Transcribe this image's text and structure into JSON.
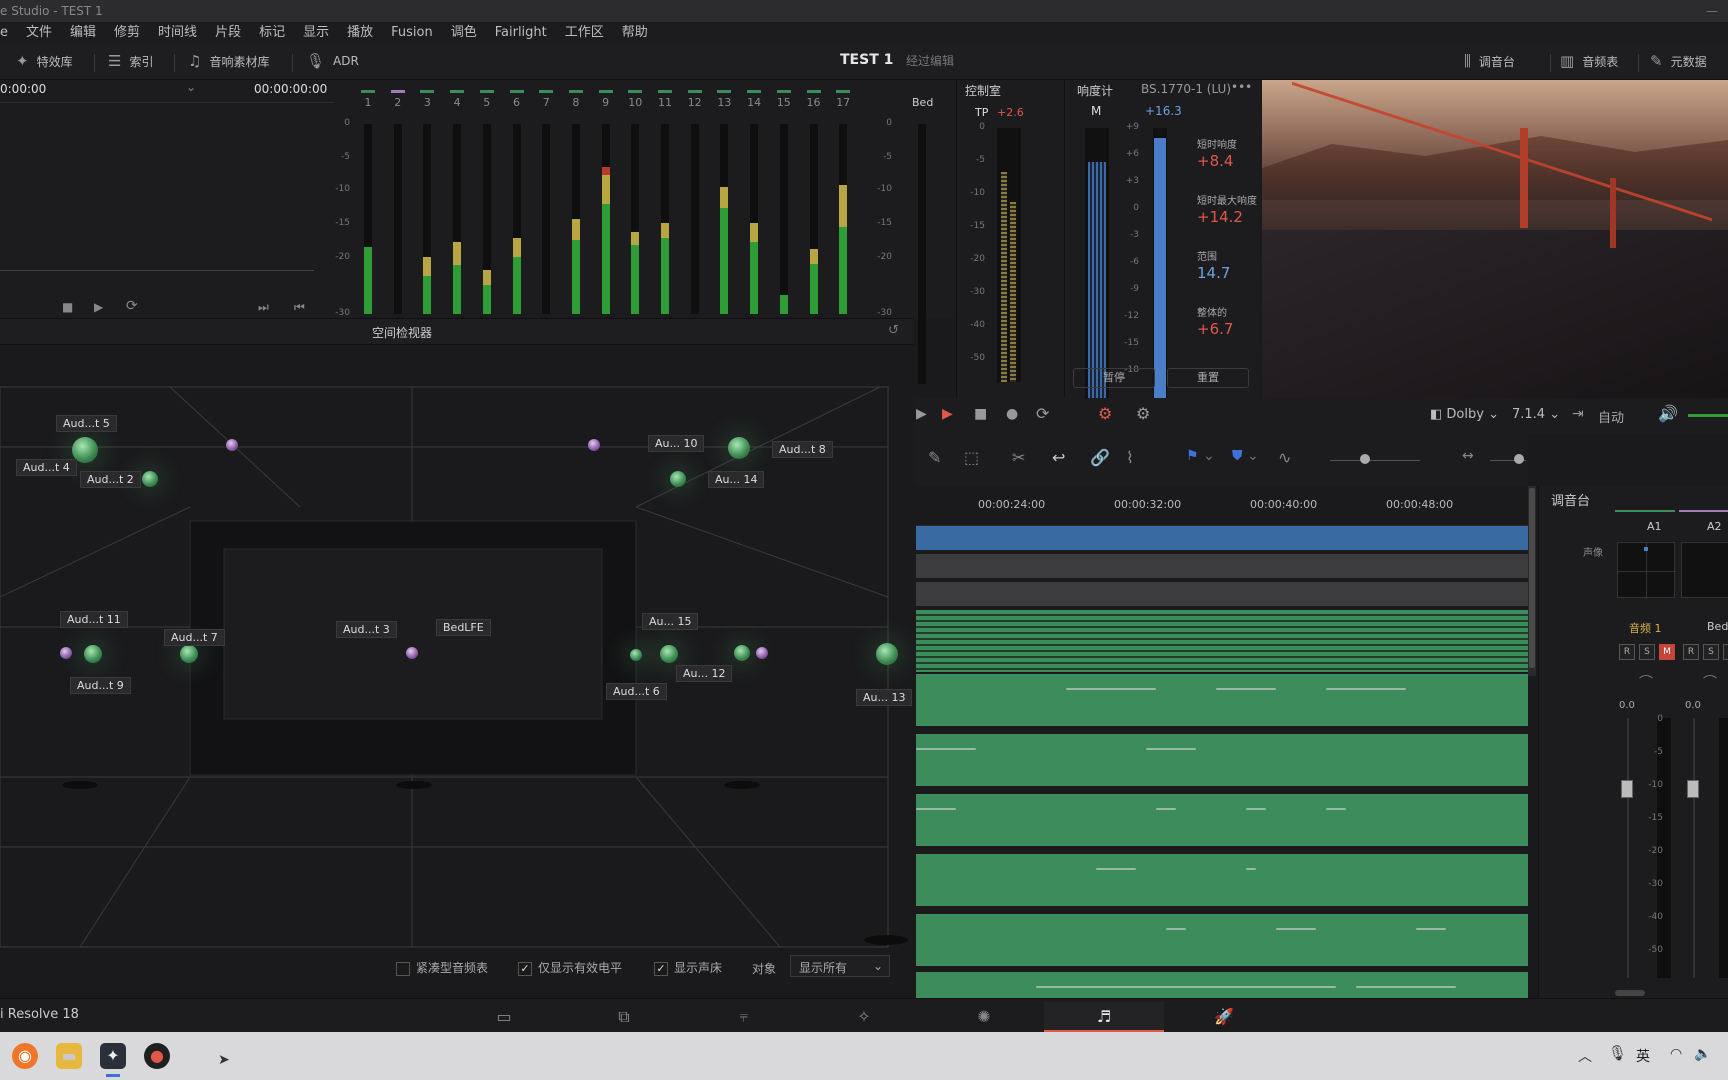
{
  "window_title": "e Studio - TEST 1",
  "menu": [
    "e",
    "文件",
    "编辑",
    "修剪",
    "时间线",
    "片段",
    "标记",
    "显示",
    "播放",
    "Fusion",
    "调色",
    "Fairlight",
    "工作区",
    "帮助"
  ],
  "toolbar": {
    "effects": "特效库",
    "index": "索引",
    "sound_library": "音响素材库",
    "adr": "ADR",
    "project": "TEST 1",
    "edited": "经过编辑",
    "mixer": "调音台",
    "meters": "音频表",
    "metadata": "元数据"
  },
  "viewer": {
    "tc_left": "0:00:00",
    "tc_right": "00:00:00:00"
  },
  "meters": {
    "channels": [
      "1",
      "2",
      "3",
      "4",
      "5",
      "6",
      "7",
      "8",
      "9",
      "10",
      "11",
      "12",
      "13",
      "14",
      "15",
      "16",
      "17"
    ],
    "bed_label": "Bed",
    "scale": [
      "0",
      "-5",
      "-10",
      "-15",
      "-20",
      "-30"
    ],
    "levels": [
      0.35,
      0.0,
      0.3,
      0.38,
      0.23,
      0.4,
      0.0,
      0.5,
      0.73,
      0.43,
      0.48,
      0.0,
      0.67,
      0.48,
      0.1,
      0.34,
      0.68
    ],
    "peaks": [
      0,
      0,
      0.1,
      0.12,
      0.08,
      0.1,
      0,
      0.11,
      0.15,
      0.07,
      0.08,
      0,
      0.11,
      0.1,
      0,
      0.08,
      0.22
    ],
    "red": [
      0,
      0,
      0,
      0,
      0,
      0,
      0,
      0,
      0.04,
      0,
      0,
      0,
      0,
      0,
      0,
      0,
      0
    ]
  },
  "control_room": {
    "title": "控制室",
    "tp_label": "TP",
    "tp_value": "+2.6",
    "scale": [
      "0",
      "-5",
      "-10",
      "-15",
      "-20",
      "-30",
      "-40",
      "-50"
    ]
  },
  "loudness": {
    "title": "响度计",
    "standard": "BS.1770-1 (LU)",
    "m_label": "M",
    "m_value": "+16.3",
    "scale": [
      "+9",
      "+6",
      "+3",
      "0",
      "-3",
      "-6",
      "-9",
      "-12",
      "-15",
      "-18"
    ],
    "short_term_label": "短时响度",
    "short_term_value": "+8.4",
    "short_max_label": "短时最大响度",
    "short_max_value": "+14.2",
    "range_label": "范围",
    "range_value": "14.7",
    "integrated_label": "整体的",
    "integrated_value": "+6.7",
    "pause": "暂停",
    "reset": "重置"
  },
  "spatial": {
    "title": "空间检视器",
    "objects": [
      "Aud...t 5",
      "Aud...t 4",
      "Aud...t 2",
      "Au... 10",
      "Aud...t 8",
      "Au... 14",
      "Aud...t 11",
      "Aud...t 9",
      "Aud...t 7",
      "Aud...t 3",
      "BedLFE",
      "Au... 15",
      "Au... 12",
      "Aud...t 6",
      "Au... 13"
    ],
    "opt_compact": "紧凑型音频表",
    "opt_active_only": "仅显示有效电平",
    "opt_show_bed": "显示声床",
    "object_label": "对象",
    "object_select": "显示所有"
  },
  "transport": {
    "format": "Dolby",
    "layout": "7.1.4",
    "auto": "自动"
  },
  "timeline": {
    "ruler": [
      "00:00:24:00",
      "00:00:32:00",
      "00:00:40:00",
      "00:00:48:00"
    ]
  },
  "mixer": {
    "title": "调音台",
    "strip1": "A1",
    "strip2": "A2",
    "pan_label": "声像",
    "track1_name": "音频 1",
    "track2_name": "Bed",
    "r": "R",
    "s": "S",
    "m": "M",
    "gain1": "0.0",
    "gain2": "0.0",
    "scale": [
      "0",
      "-5",
      "-10",
      "-15",
      "-20",
      "-30",
      "-40",
      "-50"
    ]
  },
  "status": {
    "app": "i Resolve 18"
  },
  "taskbar": {
    "ime": "英"
  },
  "colors": {
    "accent_red": "#e0584a",
    "meter_green": "#2f9d35",
    "loud_blue": "#4a7ec9",
    "clip_green": "#3d8d5c"
  }
}
